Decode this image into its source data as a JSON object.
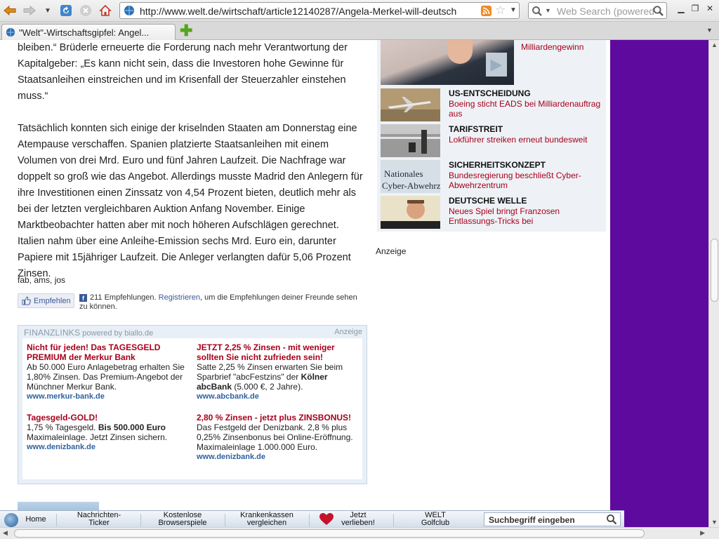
{
  "browser": {
    "url": "http://www.welt.de/wirtschaft/article12140287/Angela-Merkel-will-deutsch",
    "search_placeholder": "Web Search (powered",
    "tab_title": "\"Welt\"-Wirtschaftsgipfel: Angel..."
  },
  "article": {
    "paragraphs": [
      "bleiben.“ Brüderle erneuerte die Forderung nach mehr Verantwortung der Kapitalgeber: „Es kann nicht sein, dass die Investoren hohe Gewinne für Staatsanleihen einstreichen und im Krisenfall der Steuerzahler einstehen muss.“",
      "Tatsächlich konnten sich einige der kriselnden Staaten am Donnerstag eine Atempause verschaffen. Spanien platzierte Staatsanleihen mit einem Volumen von drei Mrd. Euro und fünf Jahren Laufzeit. Die Nachfrage war doppelt so groß wie das Angebot. Allerdings musste Madrid den Anlegern für ihre Investitionen einen Zinssatz von 4,54 Prozent bieten, deutlich mehr als bei der letzten vergleichbaren Auktion Anfang November. Einige Marktbeobachter hatten aber mit noch höheren Aufschlägen gerechnet. Italien nahm über eine Anleihe-Emission sechs Mrd. Euro ein, darunter Papiere mit 15jähriger Laufzeit. Die Anleger verlangten dafür 5,06 Prozent Zinsen."
    ],
    "byline": "fab, ams, jos"
  },
  "facebook": {
    "button_label": "Empfehlen",
    "count_text": "211 Empfehlungen.",
    "register_link": "Registrieren",
    "rest_text": ", um die Empfehlungen deiner Freunde sehen zu können."
  },
  "finanzlinks": {
    "title": "FINANZLINKS",
    "powered": "powered by biallo.de",
    "anzeige": "Anzeige",
    "ads": [
      {
        "title": "Nicht für jeden! Das TAGESGELD PREMIUM der Merkur Bank",
        "body": "Ab 50.000 Euro Anlagebetrag erhalten Sie 1,80% Zinsen. Das Premium-Angebot der Münchner Merkur Bank.",
        "url": "www.merkur-bank.de"
      },
      {
        "title": "JETZT 2,25 % Zinsen - mit weniger sollten Sie nicht zufrieden sein!",
        "body_pre": "Satte 2,25 % Zinsen erwarten Sie beim Sparbrief \"abcFestzins\" der ",
        "body_bold": "Kölner abcBank",
        "body_post": " (5.000 €, 2 Jahre).",
        "url": "www.abcbank.de"
      },
      {
        "title": "Tagesgeld-GOLD!",
        "body_pre": "1,75 % Tagesgeld. ",
        "body_bold": "Bis 500.000 Euro",
        "body_post": " Maximaleinlage. Jetzt Zinsen sichern.",
        "url": "www.denizbank.de"
      },
      {
        "title": "2,80 % Zinsen - jetzt plus ZINSBONUS!",
        "body": "Das Festgeld der Denizbank. 2,8 % plus 0,25% Zinsenbonus bei Online-Eröffnung. Maximaleinlage 1.000.000 Euro.",
        "url": "www.denizbank.de"
      }
    ]
  },
  "sidebar": {
    "hero_caption": "Milliardengewinn",
    "teasers": [
      {
        "kicker": "US-ENTSCHEIDUNG",
        "headline": "Boeing sticht EADS bei Milliardenauftrag aus"
      },
      {
        "kicker": "TARIFSTREIT",
        "headline": "Lokführer streiken erneut bundesweit"
      },
      {
        "kicker": "SICHERHEITSKONZEPT",
        "headline": "Bundesregierung beschließt Cyber-Abwehrzentrum"
      },
      {
        "kicker": "DEUTSCHE WELLE",
        "headline": "Neues Spiel bringt Franzosen Entlassungs-Tricks bei"
      }
    ],
    "thumb_text": [
      "Nationales",
      "Cyber-Abwehrzentrum"
    ],
    "anzeige": "Anzeige"
  },
  "weltbar": {
    "items": [
      "Home",
      "Nachrichten-\nTicker",
      "Kostenlose\nBrowserspiele",
      "Krankenkassen\nvergleichen",
      "Jetzt\nverlieben!",
      "WELT\nGolfclub"
    ],
    "search_placeholder": "Suchbegriff eingeben"
  }
}
